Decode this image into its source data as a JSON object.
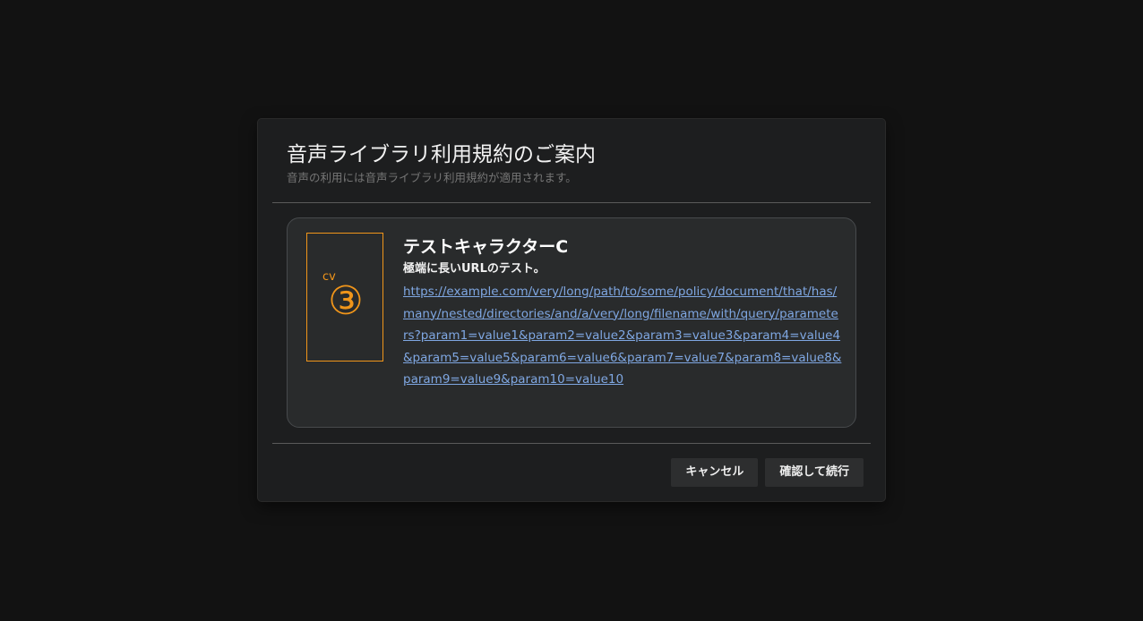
{
  "dialog": {
    "title": "音声ライブラリ利用規約のご案内",
    "subtitle": "音声の利用には音声ライブラリ利用規約が適用されます。"
  },
  "character": {
    "name": "テストキャラクターC",
    "description": "極端に長いURLのテスト。",
    "portrait_mark": {
      "small_text": "cv",
      "symbol": "③",
      "color": "#f0951a"
    },
    "terms_url": "https://example.com/very/long/path/to/some/policy/document/that/has/many/nested/directories/and/a/very/long/filename/with/query/parameters?param1=value1&param2=value2&param3=value3&param4=value4&param5=value5&param6=value6&param7=value7&param8=value8&param9=value9&param10=value10"
  },
  "actions": {
    "cancel_label": "キャンセル",
    "confirm_label": "確認して続行"
  },
  "colors": {
    "background": "#121212",
    "dialog": "#1d1e1f",
    "card": "#292b2c",
    "accent": "#f0951a",
    "link": "#7fa7e2"
  }
}
